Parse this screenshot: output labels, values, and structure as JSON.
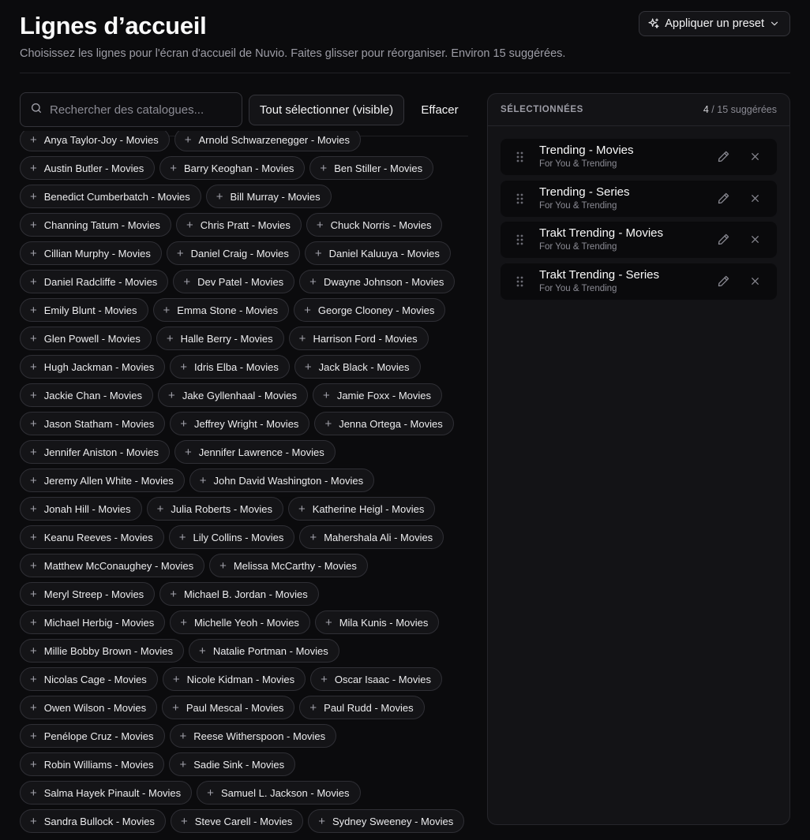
{
  "header": {
    "title": "Lignes d’accueil",
    "subtitle": "Choisissez les lignes pour l'écran d'accueil de Nuvio. Faites glisser pour réorganiser. Environ 15 suggérées.",
    "preset_label": "Appliquer un preset"
  },
  "toolbar": {
    "search_placeholder": "Rechercher des catalogues...",
    "search_value": "",
    "select_all_label": "Tout sélectionner (visible)",
    "clear_label": "Effacer"
  },
  "catalog_rows": [
    [
      "Anya Taylor-Joy - Movies",
      "Arnold Schwarzenegger - Movies"
    ],
    [
      "Austin Butler - Movies",
      "Barry Keoghan - Movies",
      "Ben Stiller - Movies"
    ],
    [
      "Benedict Cumberbatch - Movies",
      "Bill Murray - Movies"
    ],
    [
      "Channing Tatum - Movies",
      "Chris Pratt - Movies",
      "Chuck Norris - Movies"
    ],
    [
      "Cillian Murphy - Movies",
      "Daniel Craig - Movies",
      "Daniel Kaluuya - Movies"
    ],
    [
      "Daniel Radcliffe - Movies",
      "Dev Patel - Movies",
      "Dwayne Johnson - Movies"
    ],
    [
      "Emily Blunt - Movies",
      "Emma Stone - Movies",
      "George Clooney - Movies"
    ],
    [
      "Glen Powell - Movies",
      "Halle Berry - Movies",
      "Harrison Ford - Movies"
    ],
    [
      "Hugh Jackman - Movies",
      "Idris Elba - Movies",
      "Jack Black - Movies"
    ],
    [
      "Jackie Chan - Movies",
      "Jake Gyllenhaal - Movies",
      "Jamie Foxx - Movies"
    ],
    [
      "Jason Statham - Movies",
      "Jeffrey Wright - Movies",
      "Jenna Ortega - Movies"
    ],
    [
      "Jennifer Aniston - Movies",
      "Jennifer Lawrence - Movies"
    ],
    [
      "Jeremy Allen White - Movies",
      "John David Washington - Movies"
    ],
    [
      "Jonah Hill - Movies",
      "Julia Roberts - Movies",
      "Katherine Heigl - Movies"
    ],
    [
      "Keanu Reeves - Movies",
      "Lily Collins - Movies",
      "Mahershala Ali - Movies"
    ],
    [
      "Matthew McConaughey - Movies",
      "Melissa McCarthy - Movies"
    ],
    [
      "Meryl Streep - Movies",
      "Michael B. Jordan - Movies"
    ],
    [
      "Michael Herbig - Movies",
      "Michelle Yeoh - Movies",
      "Mila Kunis - Movies"
    ],
    [
      "Millie Bobby Brown - Movies",
      "Natalie Portman - Movies"
    ],
    [
      "Nicolas Cage - Movies",
      "Nicole Kidman - Movies",
      "Oscar Isaac - Movies"
    ],
    [
      "Owen Wilson - Movies",
      "Paul Mescal - Movies",
      "Paul Rudd - Movies"
    ],
    [
      "Penélope Cruz - Movies",
      "Reese Witherspoon - Movies"
    ],
    [
      "Robin Williams - Movies",
      "Sadie Sink - Movies"
    ],
    [
      "Salma Hayek Pinault - Movies",
      "Samuel L. Jackson - Movies"
    ],
    [
      "Sandra Bullock - Movies",
      "Steve Carell - Movies",
      "Sydney Sweeney - Movies"
    ]
  ],
  "selected_panel": {
    "title": "SÉLECTIONNÉES",
    "count": "4",
    "count_suffix": " / 15 suggérées",
    "items": [
      {
        "title": "Trending - Movies",
        "subtitle": "For You & Trending"
      },
      {
        "title": "Trending - Series",
        "subtitle": "For You & Trending"
      },
      {
        "title": "Trakt Trending - Movies",
        "subtitle": "For You & Trending"
      },
      {
        "title": "Trakt Trending - Series",
        "subtitle": "For You & Trending"
      }
    ]
  },
  "icons": {
    "preset": "sparkles-icon",
    "dropdown": "chevron-down-icon",
    "search": "search-icon",
    "add": "plus-icon",
    "drag": "grip-vertical-icon",
    "edit": "pencil-icon",
    "remove": "close-icon"
  },
  "colors": {
    "background": "#0b0b0d",
    "panel": "#131316",
    "chip": "#141417",
    "border": "#2f2f35",
    "muted_text": "#9d9da6"
  }
}
